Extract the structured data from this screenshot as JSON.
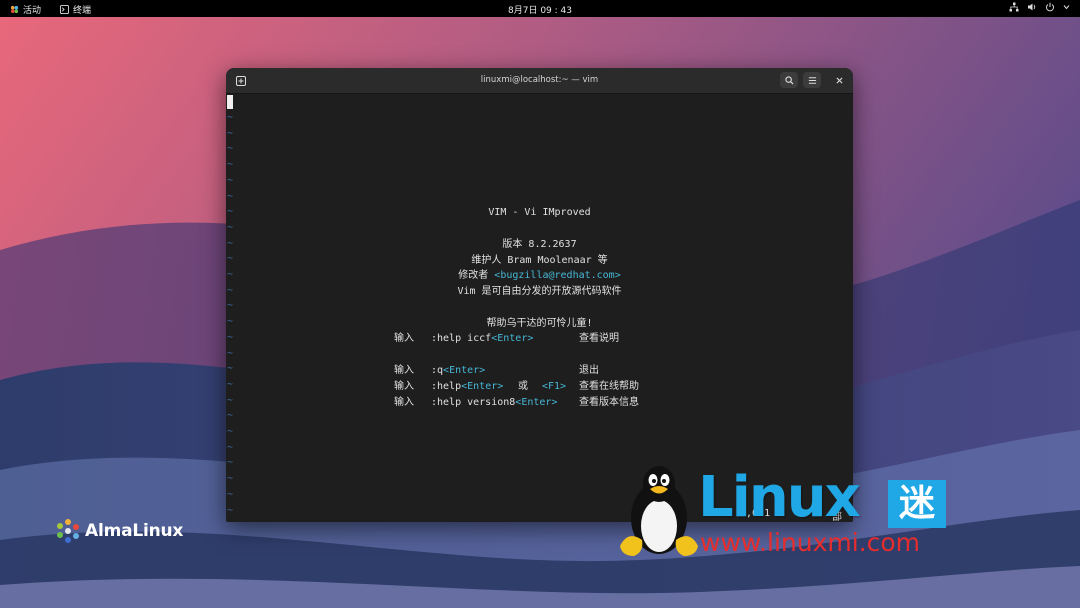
{
  "topbar": {
    "activities_label": "活动",
    "app_label": "终端",
    "clock": "8月7日 09 : 43"
  },
  "window": {
    "title": "linuxmi@localhost:~ — vim",
    "tab_icon": "new-tab-icon",
    "search_icon": "search-icon",
    "menu_icon": "hamburger-menu-icon",
    "close_icon": "close-icon"
  },
  "vim": {
    "title": "VIM - Vi IMproved",
    "version_line": "版本 8.2.2637",
    "maintainer_line": "维护人 Bram Moolenaar 等",
    "modified_by": "修改者 ",
    "modified_email": "<bugzilla@redhat.com>",
    "license_line": "Vim 是可自由分发的开放源代码软件",
    "help_uganda": "帮助乌干达的可怜儿童!",
    "rows": [
      {
        "input": "输入",
        "cmd": ":help iccf",
        "key": "<Enter>",
        "mid": "",
        "key2": "",
        "desc": "查看说明"
      },
      {
        "input": "输入",
        "cmd": ":q",
        "key": "<Enter>",
        "mid": "",
        "key2": "",
        "desc": "退出"
      },
      {
        "input": "输入",
        "cmd": ":help",
        "key": "<Enter>",
        "mid": "或",
        "key2": "<F1>",
        "desc": "查看在线帮助"
      },
      {
        "input": "输入",
        "cmd": ":help version8",
        "key": "<Enter>",
        "mid": "",
        "key2": "",
        "desc": "查看版本信息"
      }
    ],
    "status_pos": "0,0-1",
    "status_all": "部"
  },
  "logos": {
    "alma": "AlmaLinux",
    "brand_word": "Linux",
    "brand_mi": "迷",
    "brand_url": "www.linuxmi.com"
  },
  "colors": {
    "accent_cyan": "#46b7d6",
    "tilde_blue": "#3e6ea8",
    "brand_blue": "#1fa7e6",
    "brand_red": "#e62d2d"
  }
}
